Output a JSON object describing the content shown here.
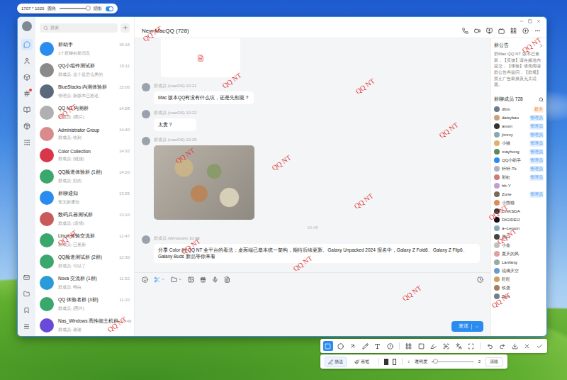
{
  "capture_bar": {
    "size": "1707 * 1020",
    "corner_label": "圆角",
    "corner_level": 0.95,
    "shadow_label": "阴影",
    "shadow_on": true
  },
  "window": {
    "title": "New MacQQ (728)"
  },
  "rail": {
    "top": [
      {
        "selected": true,
        "dot": false
      },
      {
        "selected": false,
        "dot": false
      },
      {
        "selected": false,
        "dot": false
      },
      {
        "selected": false,
        "dot": true
      },
      {
        "selected": false,
        "dot": false
      },
      {
        "selected": false,
        "dot": false
      },
      {
        "selected": false,
        "dot": false
      }
    ],
    "bottom": [
      {
        "selected": false
      },
      {
        "selected": false
      },
      {
        "selected": false
      },
      {
        "selected": false
      }
    ]
  },
  "search": {
    "placeholder": "搜索"
  },
  "chats": [
    {
      "name": "群助手",
      "preview": "1个群聊有新消息",
      "time": "15:15",
      "color": "#2b8cf0"
    },
    {
      "name": "QQ小组件测试群",
      "preview": "群成员: 这个是怎么弄的",
      "time": "15:11",
      "color": "#8a8a8a"
    },
    {
      "name": "BlueStacks 内测体验群",
      "preview": "管理员: 新版本已推送",
      "time": "15:06",
      "color": "#5a6a7a"
    },
    {
      "name": "QQ NT 内测群",
      "preview": "群成员: [图片]",
      "time": "14:58",
      "color": "#b0b0b0"
    },
    {
      "name": "Administrator Group",
      "preview": "群成员: 收到",
      "time": "14:40",
      "color": "#d98a8a"
    },
    {
      "name": "Color Collection",
      "preview": "群成员: [链接]",
      "time": "14:32",
      "color": "#d9364a"
    },
    {
      "name": "QQ频道体验群 (1群)",
      "preview": "群成员: 好的",
      "time": "14:20",
      "color": "#3aa76d"
    },
    {
      "name": "群聊通知",
      "preview": "暂无新通知",
      "time": "13:55",
      "color": "#2b8cf0"
    },
    {
      "name": "数码兵器测试群",
      "preview": "群成员: [表情]",
      "time": "13:10",
      "color": "#c85a5a"
    },
    {
      "name": "Linux 体验交流群",
      "preview": "群成员: 已更新",
      "time": "12:47",
      "color": "#3aa76d"
    },
    {
      "name": "QQ频道测试群 (2群)",
      "preview": "群成员: 可以了",
      "time": "12:30",
      "color": "#3aa76d"
    },
    {
      "name": "Nova 交流群 (1群)",
      "preview": "群成员: 明白",
      "time": "11:52",
      "color": "#2b9ad9"
    },
    {
      "name": "QQ 体验者群 (3群)",
      "preview": "群成员: [图片]",
      "time": "11:20",
      "color": "#3aa76d"
    },
    {
      "name": "Nas_Windows 高性能主机群",
      "preview": "群成员: 谢谢",
      "time": "10:48",
      "color": "#6a4ad9"
    }
  ],
  "messages": [
    {
      "kind": "card",
      "sender": "",
      "text": ""
    },
    {
      "kind": "text",
      "sender": "群成员 (macOS) 10:21",
      "text": "Mac 版本QQ有没有什么坑，还是先别更？"
    },
    {
      "kind": "text",
      "sender": "群成员 (macOS) 10:22",
      "text": "太贵？"
    },
    {
      "kind": "image",
      "sender": "群成员 (macOS) 10:25",
      "text": ""
    },
    {
      "kind": "time",
      "sender": "",
      "text": "10:48"
    },
    {
      "kind": "text",
      "sender": "群成员 (Windows) 10:48",
      "text": "分享 Color 对 QQ NT 全平台的看法：桌面端已基本统一架构，期待后续更新。Galaxy Unpacked 2024 报名中，Galaxy Z Fold6、Galaxy Z Flip6、Galaxy Buds 新品等你来看"
    }
  ],
  "composer": {
    "tools": [
      {
        "selected": false
      },
      {
        "selected": true
      },
      {
        "selected": false
      },
      {
        "selected": false
      },
      {
        "selected": false
      },
      {
        "selected": false
      },
      {
        "selected": false
      }
    ],
    "send": "发送"
  },
  "notice": {
    "title": "群公告",
    "text": "群Mac QQ NT 版本已更新，【反馈】请在频道内提交，【体验】请先阅读群公告再提问，【群规】禁止广告刷屏及无关话题。"
  },
  "members": {
    "title": "群聊成员 728",
    "items": [
      {
        "name": "dbm",
        "role": "群主",
        "kind": "owner",
        "color": "#6a7a8a"
      },
      {
        "name": "daisybao",
        "role": "管理员",
        "kind": "admin",
        "color": "#c9a27a"
      },
      {
        "name": "anom",
        "role": "管理员",
        "kind": "admin",
        "color": "#333333"
      },
      {
        "name": "jimmy",
        "role": "管理员",
        "kind": "admin",
        "color": "#88aaaa"
      },
      {
        "name": "小猫",
        "role": "管理员",
        "kind": "admin",
        "color": "#e0b070"
      },
      {
        "name": "mayhong",
        "role": "管理员",
        "kind": "admin",
        "color": "#5a8a5a"
      },
      {
        "name": "QQ小助手",
        "role": "管理员",
        "kind": "admin",
        "color": "#2b8cf0"
      },
      {
        "name": "轩轩-Tk",
        "role": "管理员",
        "kind": "admin",
        "color": "#b0b0c0"
      },
      {
        "name": "彩虹",
        "role": "管理员",
        "kind": "admin",
        "color": "#d07a7a"
      },
      {
        "name": "hh-Y",
        "role": "",
        "kind": "member",
        "color": "#c0a0d0"
      },
      {
        "name": "Zone",
        "role": "管理员",
        "kind": "admin",
        "color": "#7a6a5a"
      },
      {
        "name": "小熊猫",
        "role": "",
        "kind": "member",
        "color": "#e08a5a"
      },
      {
        "name": "LINKSDA",
        "role": "",
        "kind": "member",
        "color": "#3a3a3a"
      },
      {
        "name": "DIGIDEIJ",
        "role": "",
        "kind": "member",
        "color": "#111111"
      },
      {
        "name": "a~Lemon",
        "role": "",
        "kind": "member",
        "color": "#88aabb"
      },
      {
        "name": "黑白",
        "role": "",
        "kind": "member",
        "color": "#444444"
      },
      {
        "name": "小鱼",
        "role": "",
        "kind": "member",
        "color": "#c0c0c0"
      },
      {
        "name": "夏天的风",
        "role": "",
        "kind": "member",
        "color": "#e0a0a0"
      },
      {
        "name": "Lanfang",
        "role": "",
        "kind": "member",
        "color": "#99aaaa"
      },
      {
        "name": "琉璃天空",
        "role": "",
        "kind": "member",
        "color": "#6a9ad0"
      },
      {
        "name": "旺旺",
        "role": "",
        "kind": "member",
        "color": "#d0a060"
      },
      {
        "name": "铁蛋",
        "role": "",
        "kind": "member",
        "color": "#a08060"
      },
      {
        "name": "Tem",
        "role": "",
        "kind": "member",
        "color": "#708090"
      }
    ]
  },
  "watermark": {
    "text": "QQ NT"
  },
  "annotation": {
    "tools": [
      {
        "selected": true
      },
      {
        "selected": false
      },
      {
        "selected": false
      },
      {
        "selected": false
      },
      {
        "selected": false
      },
      {
        "selected": false
      },
      {
        "selected": false
      },
      {
        "selected": false
      },
      {
        "selected": false
      },
      {
        "selected": false
      },
      {
        "selected": false
      },
      {
        "selected": false
      },
      {
        "selected": false
      },
      {
        "selected": false
      },
      {
        "selected": false
      },
      {
        "selected": false
      },
      {
        "selected": false
      }
    ],
    "modes": [
      {
        "label": "描边",
        "selected": true
      },
      {
        "label": "画笔",
        "selected": false
      }
    ],
    "fills": [
      {
        "selected": true
      },
      {
        "selected": false
      }
    ],
    "opacity_label": "透明度",
    "level": 0.1,
    "value": "2",
    "clear": "清除"
  }
}
